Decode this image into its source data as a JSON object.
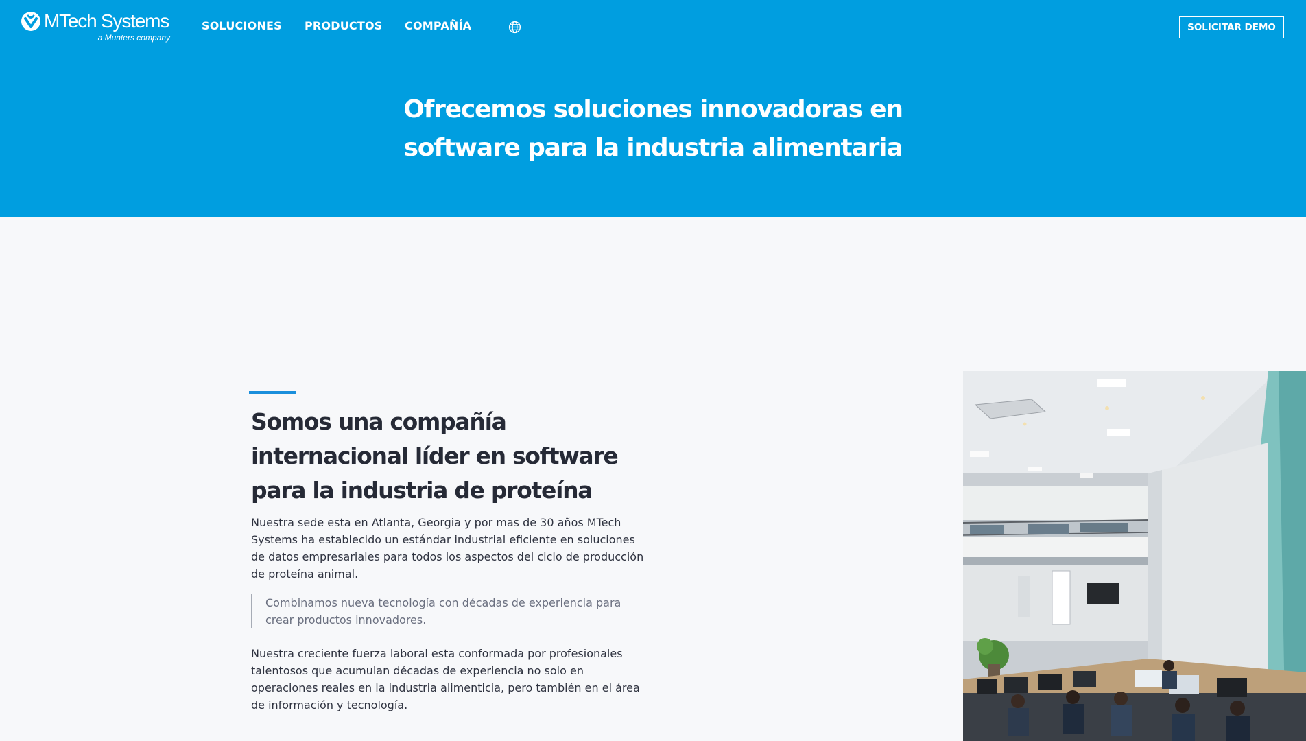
{
  "brand": {
    "name": "MTech Systems",
    "tagline": "a Munters company",
    "header_color": "#009ee0"
  },
  "nav": {
    "items": [
      {
        "label": "SOLUCIONES"
      },
      {
        "label": "PRODUCTOS"
      },
      {
        "label": "COMPAÑÍA"
      }
    ],
    "language_icon": "globe-icon",
    "cta_label": "SOLICITAR DEMO"
  },
  "hero": {
    "title": "Ofrecemos soluciones innovadoras en software para la industria alimentaria"
  },
  "about": {
    "title": "Somos una compañía internacional líder en software para la industria de proteína",
    "paragraph1": "Nuestra sede esta en Atlanta, Georgia y por mas de 30 años MTech Systems ha establecido un estándar industrial eficiente en soluciones de datos empresariales para todos los aspectos del ciclo de producción de proteína animal.",
    "quote": "Combinamos nueva tecnología con décadas de experiencia para crear productos innovadores.",
    "paragraph2": "Nuestra creciente fuerza laboral esta conformada por profesionales talentosos que acumulan décadas de experiencia no solo en operaciones reales en la industria alimenticia, pero también en el área de información y tecnología."
  }
}
